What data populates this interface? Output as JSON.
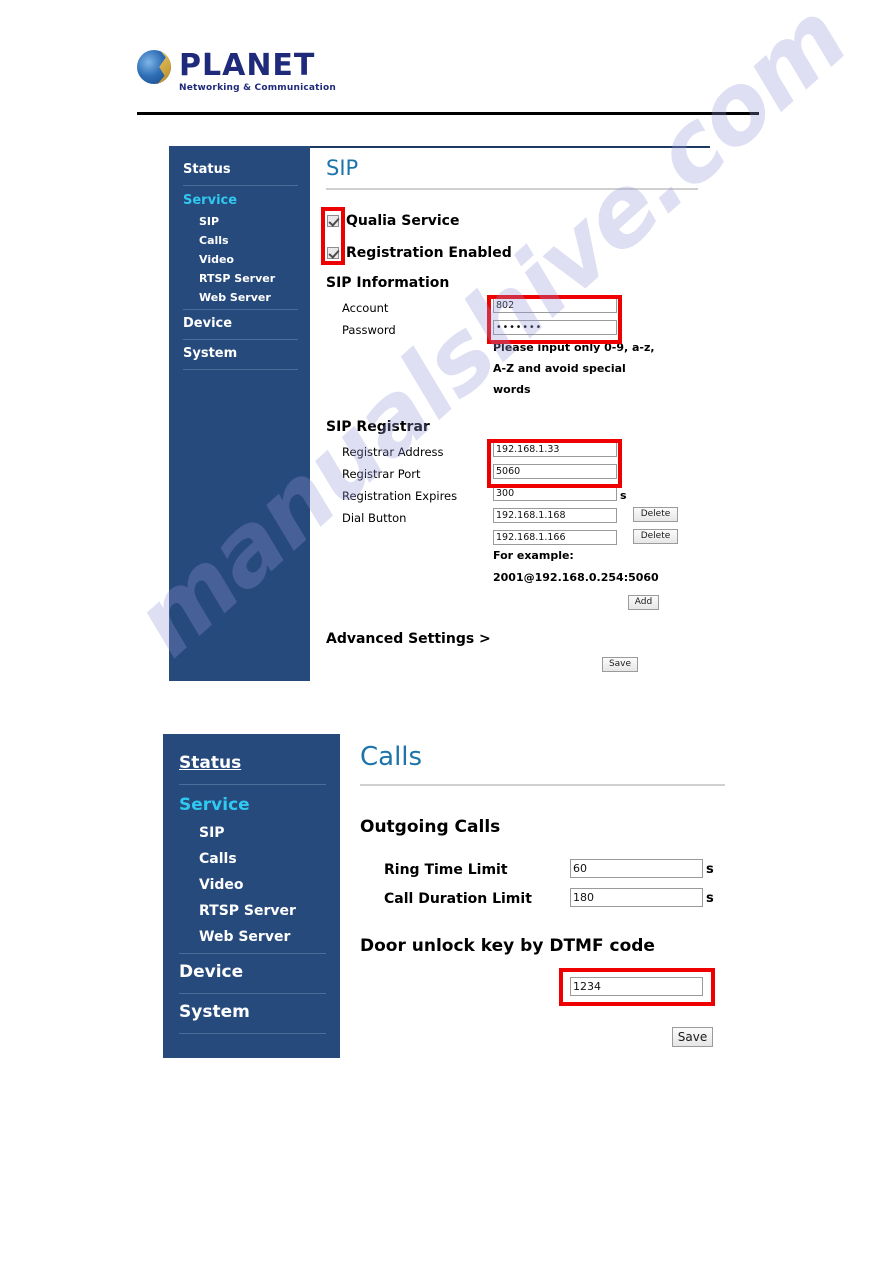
{
  "header": {
    "brand": "PLANET",
    "tagline": "Networking & Communication"
  },
  "watermark": {
    "text": "manualshive.com"
  },
  "sidebar": {
    "items": [
      {
        "label": "Status",
        "type": "top"
      },
      {
        "label": "Service",
        "type": "group"
      },
      {
        "label": "SIP",
        "type": "sub"
      },
      {
        "label": "Calls",
        "type": "sub"
      },
      {
        "label": "Video",
        "type": "sub"
      },
      {
        "label": "RTSP Server",
        "type": "sub"
      },
      {
        "label": "Web Server",
        "type": "sub"
      },
      {
        "label": "Device",
        "type": "top"
      },
      {
        "label": "System",
        "type": "top"
      }
    ]
  },
  "panel_sip": {
    "title": "SIP",
    "checkboxes": [
      {
        "label": "Qualia Service",
        "checked": true
      },
      {
        "label": "Registration Enabled",
        "checked": true
      }
    ],
    "sip_information": {
      "heading": "SIP Information",
      "account_label": "Account",
      "account_value": "802",
      "password_label": "Password",
      "password_value": "•••••••",
      "hint_line1": "Please input only 0-9, a-z,",
      "hint_line2": "A-Z and avoid special",
      "hint_line3": "words"
    },
    "sip_registrar": {
      "heading": "SIP Registrar",
      "registrar_address_label": "Registrar Address",
      "registrar_address_value": "192.168.1.33",
      "registrar_port_label": "Registrar Port",
      "registrar_port_value": "5060",
      "registration_expires_label": "Registration Expires",
      "registration_expires_value": "300",
      "registration_expires_unit": "s",
      "dial_button_label": "Dial Button",
      "dial_entries": [
        {
          "value": "192.168.1.168",
          "delete_label": "Delete"
        },
        {
          "value": "192.168.1.166",
          "delete_label": "Delete"
        }
      ],
      "example_label": "For example:",
      "example_value": "2001@192.168.0.254:5060",
      "add_label": "Add"
    },
    "advanced_settings": "Advanced Settings  >",
    "save_label": "Save"
  },
  "panel_calls": {
    "title": "Calls",
    "outgoing": {
      "heading": "Outgoing Calls",
      "ring_time_limit_label": "Ring Time Limit",
      "ring_time_limit_value": "60",
      "ring_time_limit_unit": "s",
      "call_duration_limit_label": "Call Duration Limit",
      "call_duration_limit_value": "180",
      "call_duration_limit_unit": "s"
    },
    "dtmf": {
      "heading": "Door unlock key by DTMF code",
      "code_value": "1234"
    },
    "save_label": "Save"
  },
  "colors": {
    "sidebar_bg": "#274a7d",
    "group_accent": "#2fc8f0",
    "title_blue": "#1c74ab",
    "highlight_red": "#ef0000",
    "brand_navy": "#202a7a"
  }
}
